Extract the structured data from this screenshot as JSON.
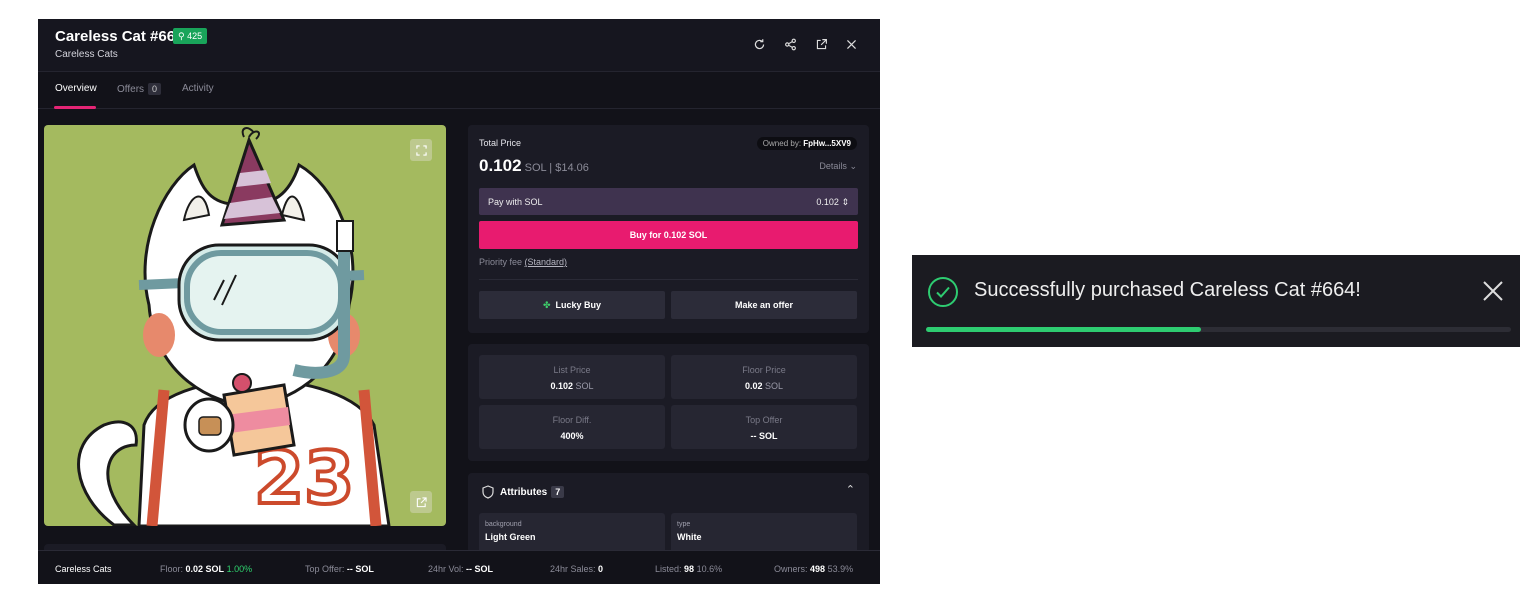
{
  "modal": {
    "title": "Careless Cat #664",
    "rank": "425",
    "collection": "Careless Cats",
    "tabs": [
      {
        "label": "Overview"
      },
      {
        "label": "Offers",
        "count": "0"
      },
      {
        "label": "Activity"
      }
    ],
    "icons": [
      "refresh-icon",
      "share-icon",
      "external-link-icon",
      "close-icon"
    ]
  },
  "image": {
    "description_icons": [
      "expand-icon",
      "external-link-icon"
    ],
    "background_color": "#a4ba5f"
  },
  "buy_panel": {
    "total_price_label": "Total Price",
    "owned_by_label": "Owned by:",
    "owner": "FpHw...5XV9",
    "price": "0.102",
    "currency": "SOL",
    "usd_price": "$14.06",
    "details_label": "Details",
    "pay_with_label": "Pay with SOL",
    "pay_amount": "0.102",
    "buy_button": "Buy for 0.102 SOL",
    "priority_fee_label": "Priority fee",
    "priority_fee_value": "(Standard)",
    "lucky_buy": "Lucky Buy",
    "make_offer": "Make an offer"
  },
  "stats": {
    "list_price": {
      "label": "List Price",
      "value": "0.102",
      "unit": "SOL"
    },
    "floor_price": {
      "label": "Floor Price",
      "value": "0.02",
      "unit": "SOL"
    },
    "floor_diff": {
      "label": "Floor Diff.",
      "value": "400%"
    },
    "top_offer": {
      "label": "Top Offer",
      "value": "--",
      "unit": "SOL"
    }
  },
  "attributes": {
    "title": "Attributes",
    "count": "7",
    "items": [
      {
        "key": "background",
        "value": "Light Green"
      },
      {
        "key": "type",
        "value": "White"
      }
    ]
  },
  "footer": {
    "collection": "Careless Cats",
    "floor_label": "Floor:",
    "floor_value": "0.02 SOL",
    "floor_change": "1.00%",
    "top_offer_label": "Top Offer:",
    "top_offer_value": "-- SOL",
    "vol_label": "24hr Vol:",
    "vol_value": "-- SOL",
    "sales_label": "24hr Sales:",
    "sales_value": "0",
    "listed_label": "Listed:",
    "listed_value": "98",
    "listed_pct": "10.6%",
    "owners_label": "Owners:",
    "owners_value": "498",
    "owners_pct": "53.9%"
  },
  "toast": {
    "message": "Successfully purchased Careless Cat #664!",
    "progress": 0.47,
    "colors": {
      "success": "#2ecc71"
    }
  },
  "colors": {
    "accent": "#e81b6f",
    "rank_badge": "#19a45a",
    "background": "#121219"
  }
}
